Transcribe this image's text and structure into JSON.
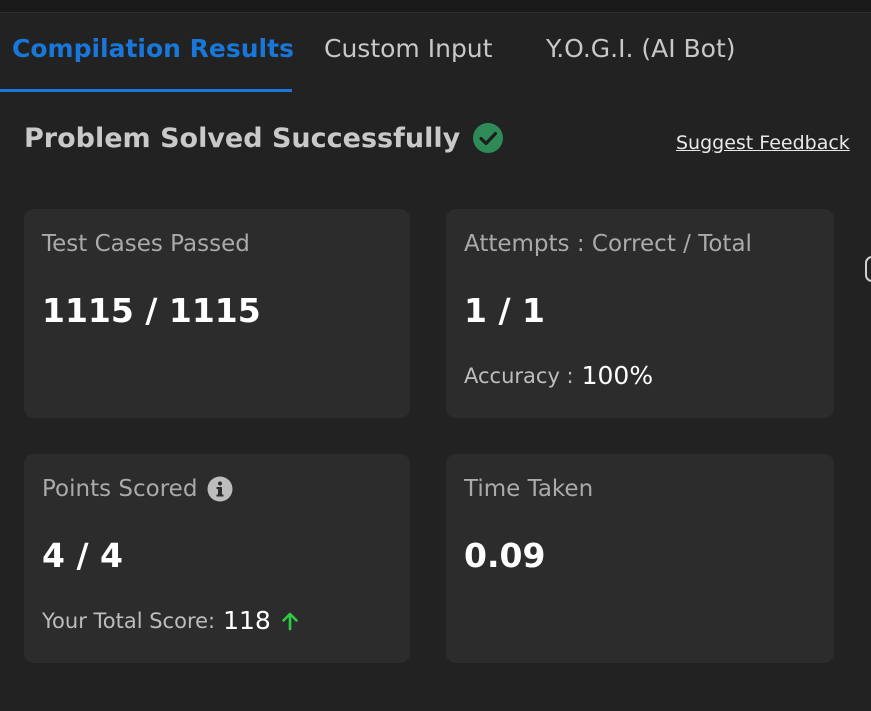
{
  "tabs": [
    {
      "label": "Compilation Results",
      "active": true
    },
    {
      "label": "Custom Input",
      "active": false
    },
    {
      "label": "Y.O.G.I. (AI Bot)",
      "active": false
    }
  ],
  "status": {
    "title": "Problem Solved Successfully",
    "icon": "check-circle-icon",
    "color": "#2e8b57"
  },
  "feedback_link": "Suggest Feedback",
  "cards": {
    "test_cases": {
      "label": "Test Cases Passed",
      "value": "1115 / 1115"
    },
    "attempts": {
      "label": "Attempts : Correct / Total",
      "value": "1 / 1",
      "sub_label": "Accuracy :",
      "sub_value": "100%"
    },
    "points": {
      "label": "Points Scored",
      "info_icon": "info-icon",
      "value": "4 / 4",
      "sub_label": "Your Total Score:",
      "sub_value": "118",
      "trend_icon": "arrow-up-icon",
      "trend_color": "#2ecc40"
    },
    "time": {
      "label": "Time Taken",
      "value": "0.09"
    }
  },
  "colors": {
    "accent": "#1877d8",
    "background": "#222222",
    "card": "#2c2c2c"
  }
}
